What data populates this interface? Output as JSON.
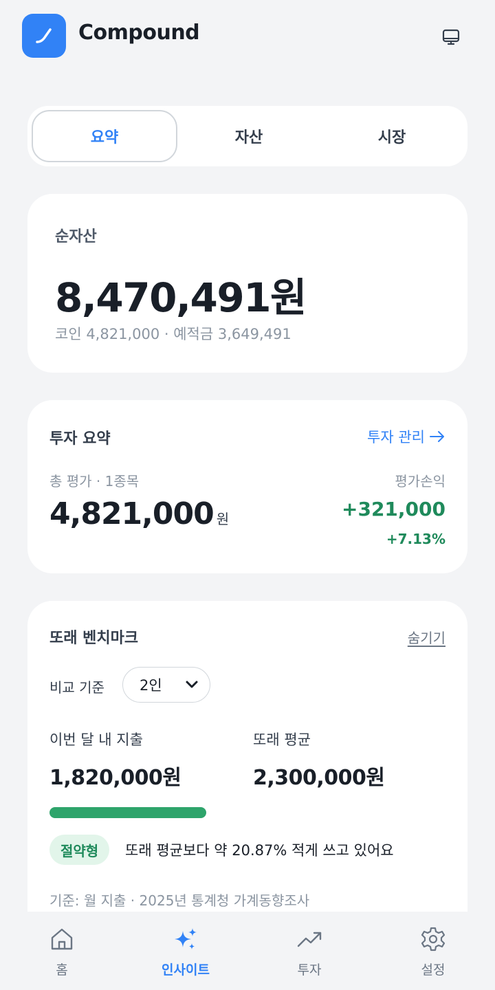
{
  "header": {
    "app_name": "Compound"
  },
  "tabs": [
    {
      "label": "요약",
      "active": true
    },
    {
      "label": "자산",
      "active": false
    },
    {
      "label": "시장",
      "active": false
    }
  ],
  "net_worth": {
    "label": "순자산",
    "amount": "8,470,491원",
    "breakdown": "코인 4,821,000 · 예적금 3,649,491"
  },
  "investment": {
    "title": "투자 요약",
    "manage_link": "투자 관리",
    "total_label": "총 평가 · 1종목",
    "total_value": "4,821,000",
    "total_unit": "원",
    "pnl_label": "평가손익",
    "pnl_value": "+321,000",
    "pnl_percent": "+7.13%"
  },
  "benchmark": {
    "title": "또래 벤치마크",
    "hide_link": "숨기기",
    "compare_label": "비교 기준",
    "compare_selected": "2인",
    "my_spend_label": "이번 달 내 지출",
    "my_spend_value": "1,820,000원",
    "peer_avg_label": "또래 평균",
    "peer_avg_value": "2,300,000원",
    "spend_ratio": 0.7913,
    "badge": "절약형",
    "badge_text": "또래 평균보다 약 20.87% 적게 쓰고 있어요",
    "footnote": "기준: 월 지출 · 2025년 통계청 가계동향조사"
  },
  "bottom_nav": [
    {
      "label": "홈",
      "icon": "home-icon",
      "active": false
    },
    {
      "label": "인사이트",
      "icon": "sparkle-icon",
      "active": true
    },
    {
      "label": "투자",
      "icon": "trending-up-icon",
      "active": false
    },
    {
      "label": "설정",
      "icon": "gear-icon",
      "active": false
    }
  ],
  "colors": {
    "accent": "#3182f6",
    "positive": "#1f8a5b",
    "bar": "#2ea46b",
    "background": "#f3f4f6"
  }
}
